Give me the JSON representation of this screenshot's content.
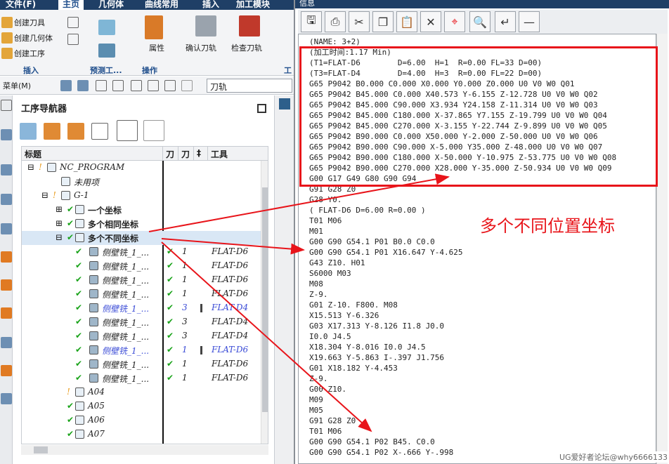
{
  "ribbon": {
    "tabs": [
      "文件(F)",
      "主页",
      "几何体",
      "曲线常用",
      "插入",
      "加工模块"
    ],
    "active_tab": "主页",
    "create_buttons": [
      "创建刀具",
      "创建几何体",
      "创建工序"
    ],
    "group_insert": "插入",
    "group_predict": "预测工...",
    "group_ops": "操作",
    "attr_label": "属性",
    "confirm_label": "确认刀轨",
    "check_label": "检查刀轨",
    "group_extra": "工"
  },
  "quickbar": {
    "menu_label": "菜单(M)",
    "toolpath_field": "刀轨"
  },
  "navigator": {
    "title": "工序导航器",
    "columns": [
      "标题",
      "刀",
      "刀",
      "‡",
      "工具"
    ],
    "rows": [
      {
        "indent": 0,
        "name": "NC_PROGRAM",
        "flag": "!",
        "tool": ""
      },
      {
        "indent": 1,
        "name": "未用项",
        "flag": "",
        "tool": ""
      },
      {
        "indent": 1,
        "name": "G-1",
        "flag": "!",
        "tool": ""
      },
      {
        "indent": 2,
        "name": "一个坐标",
        "flag": "✔",
        "tool": ""
      },
      {
        "indent": 2,
        "name": "多个相同坐标",
        "flag": "✔",
        "tool": ""
      },
      {
        "indent": 2,
        "name": "多个不同坐标",
        "flag": "✔",
        "tool": ""
      },
      {
        "indent": 3,
        "name": "侧壁铣_1_...",
        "c1": "1",
        "tool": "FLAT-D6"
      },
      {
        "indent": 3,
        "name": "侧壁铣_1_...",
        "c1": "1",
        "tool": "FLAT-D6"
      },
      {
        "indent": 3,
        "name": "侧壁铣_1_...",
        "c1": "1",
        "tool": "FLAT-D6"
      },
      {
        "indent": 3,
        "name": "侧壁铣_1_...",
        "c1": "1",
        "tool": "FLAT-D6"
      },
      {
        "indent": 3,
        "name": "侧壁铣_1_...",
        "c1": "3",
        "tool": "FLAT-D4",
        "blue": true
      },
      {
        "indent": 3,
        "name": "侧壁铣_1_...",
        "c1": "3",
        "tool": "FLAT-D4"
      },
      {
        "indent": 3,
        "name": "侧壁铣_1_...",
        "c1": "3",
        "tool": "FLAT-D4"
      },
      {
        "indent": 3,
        "name": "侧壁铣_1_...",
        "c1": "1",
        "tool": "FLAT-D6",
        "blue": true
      },
      {
        "indent": 3,
        "name": "侧壁铣_1_...",
        "c1": "1",
        "tool": "FLAT-D6"
      },
      {
        "indent": 3,
        "name": "侧壁铣_1_...",
        "c1": "1",
        "tool": "FLAT-D6"
      },
      {
        "indent": 2,
        "name": "A04",
        "flag": "!",
        "tool": ""
      },
      {
        "indent": 2,
        "name": "A05",
        "flag": "✔",
        "tool": ""
      },
      {
        "indent": 2,
        "name": "A06",
        "flag": "✔",
        "tool": ""
      },
      {
        "indent": 2,
        "name": "A07",
        "flag": "✔",
        "tool": ""
      }
    ]
  },
  "nc": {
    "title": "信息",
    "lines": [
      "(NAME: 3+2)",
      "(加工时间:1.17 Min)",
      "(T1=FLAT-D6        D=6.00  H=1  R=0.00 FL=33 D=00)",
      "(T3=FLAT-D4        D=4.00  H=3  R=0.00 FL=22 D=00)",
      "G65 P9042 B0.000 C0.000 X0.000 Y0.000 Z0.000 U0 V0 W0 Q01",
      "G65 P9042 B45.000 C0.000 X40.573 Y-6.155 Z-12.728 U0 V0 W0 Q02",
      "G65 P9042 B45.000 C90.000 X3.934 Y24.158 Z-11.314 U0 V0 W0 Q03",
      "G65 P9042 B45.000 C180.000 X-37.865 Y7.155 Z-19.799 U0 V0 W0 Q04",
      "G65 P9042 B45.000 C270.000 X-3.155 Y-22.744 Z-9.899 U0 V0 W0 Q05",
      "G65 P9042 B90.000 C0.000 X50.000 Y-2.000 Z-50.000 U0 V0 W0 Q06",
      "G65 P9042 B90.000 C90.000 X-5.000 Y35.000 Z-48.000 U0 V0 W0 Q07",
      "G65 P9042 B90.000 C180.000 X-50.000 Y-10.975 Z-53.775 U0 V0 W0 Q08",
      "G65 P9042 B90.000 C270.000 X28.000 Y-35.000 Z-50.934 U0 V0 W0 Q09",
      "G00 G17 G49 G80 G90 G94",
      "G91 G28 Z0",
      "G28 Y0.",
      "( FLAT-D6 D=6.00 R=0.00 )",
      "T01 M06",
      "M01",
      "G00 G90 G54.1 P01 B0.0 C0.0",
      "G00 G90 G54.1 P01 X16.647 Y-4.625",
      "G43 Z10. H01",
      "S6000 M03",
      "M08",
      "Z-9.",
      "G01 Z-10. F800. M08",
      "X15.513 Y-6.326",
      "G03 X17.313 Y-8.126 I1.8 J0.0",
      "I0.0 J4.5",
      "X18.304 Y-8.016 I0.0 J4.5",
      "X19.663 Y-5.863 I-.397 J1.756",
      "G01 X18.182 Y-4.453",
      "Z-9.",
      "G00 Z10.",
      "M09",
      "M05",
      "G91 G28 Z0",
      "T01 M06",
      "G00 G90 G54.1 P02 B45. C0.0",
      "G00 G90 G54.1 P02 X-.666 Y-.998"
    ]
  },
  "annotation": "多个不同位置坐标",
  "watermark": "UG爱好者论坛@why6666133",
  "colors": {
    "accent": "#1f4e8c",
    "annotation_red": "#e8141a",
    "check_green": "#1aa31a",
    "highlight": "#d9e7f5"
  }
}
